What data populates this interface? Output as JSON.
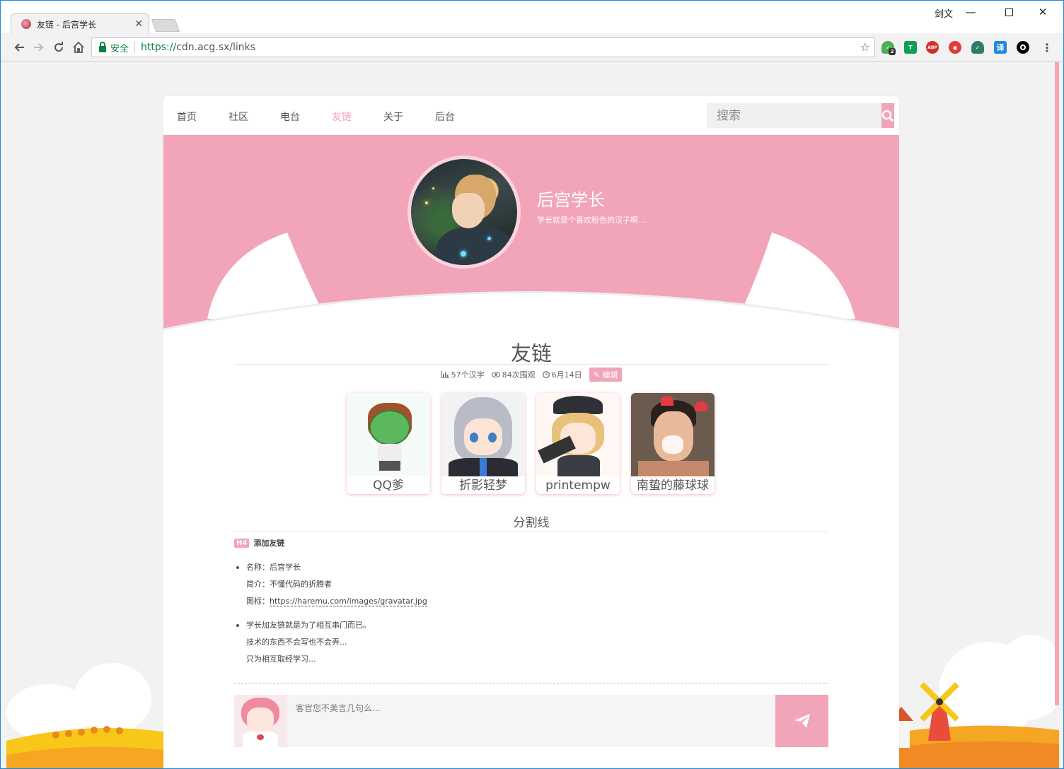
{
  "browser": {
    "tab_title": "友链 - 后宫学长",
    "user_name": "剑文",
    "secure_label": "安全",
    "url_scheme": "https://",
    "url_rest": "cdn.acg.sx/links",
    "extension_badge": "2",
    "abp_label": "ABP",
    "translate_label": "译"
  },
  "nav": {
    "items": [
      "首页",
      "社区",
      "电台",
      "友链",
      "关于",
      "后台"
    ],
    "active_index": 3,
    "search_placeholder": "搜索"
  },
  "hero": {
    "name": "后宫学长",
    "description": "学长就是个喜欢粉色的汉子啊..."
  },
  "article": {
    "title": "友链",
    "meta": {
      "words": "57个汉字",
      "views": "84次围观",
      "date": "6月14日",
      "edit_label": "编辑"
    },
    "links": [
      {
        "name": "QQ爹"
      },
      {
        "name": "折影轻梦"
      },
      {
        "name": "printempw"
      },
      {
        "name": "南蛰的藤球球"
      }
    ],
    "divider_title": "分割线",
    "h4_tag": "H4",
    "h4_text": "添加友链",
    "info": {
      "name_line": "名称：后宫学长",
      "intro_line": "简介：不懂代码的折腾者",
      "icon_label": "图标：",
      "icon_url": "https://haremu.com/images/gravatar.jpg"
    },
    "notes": [
      "学长加友链就是为了相互串门而已。",
      "技术的东西不会写也不会弄...",
      "只为相互取经学习..."
    ]
  },
  "comment": {
    "placeholder": "客官您不美言几句么..."
  },
  "colors": {
    "accent": "#f2a4b8",
    "secure": "#0b8043"
  }
}
